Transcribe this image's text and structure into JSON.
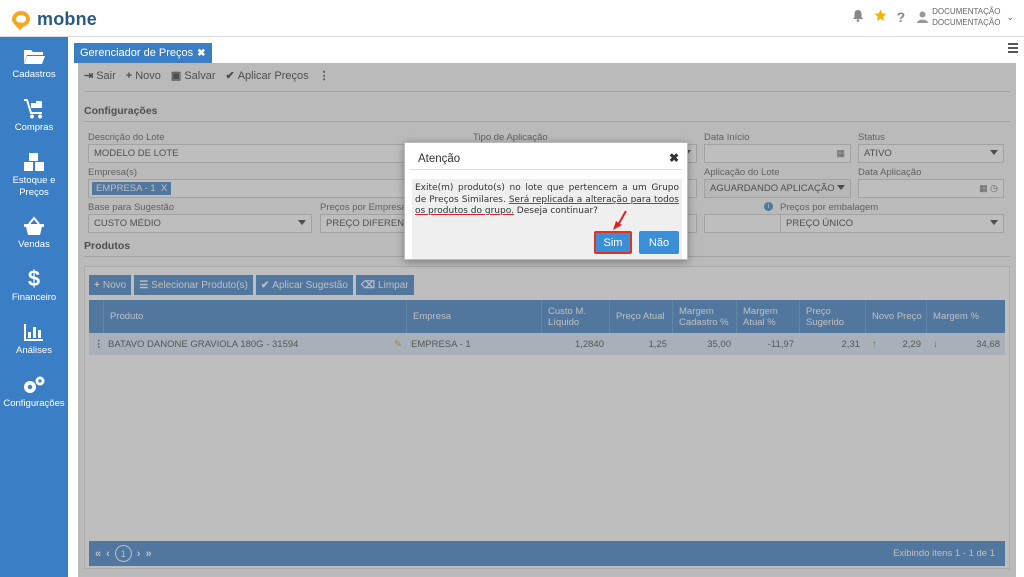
{
  "app": {
    "name": "mobne"
  },
  "header": {
    "user_line1": "DOCUMENTAÇÃO",
    "user_line2": "DOCUMENTAÇÃO"
  },
  "sidebar": {
    "items": [
      {
        "label": "Cadastros",
        "icon": "folder-icon"
      },
      {
        "label": "Compras",
        "icon": "cart-icon"
      },
      {
        "label": "Estoque e Preços",
        "icon": "boxes-icon"
      },
      {
        "label": "Vendas",
        "icon": "basket-icon"
      },
      {
        "label": "Financeiro",
        "icon": "dollar-icon"
      },
      {
        "label": "Análises",
        "icon": "bar-chart-icon"
      },
      {
        "label": "Configurações",
        "icon": "gears-icon"
      }
    ]
  },
  "tab": {
    "label": "Gerenciador de Preços"
  },
  "toolbar": {
    "exit": "Sair",
    "new": "Novo",
    "save": "Salvar",
    "apply": "Aplicar Preços"
  },
  "config": {
    "title": "Configurações",
    "lot_desc_label": "Descrição do Lote",
    "lot_desc_value": "MODELO DE LOTE",
    "app_type_label": "Tipo de Aplicação",
    "start_date_label": "Data Início",
    "status_label": "Status",
    "status_value": "ATIVO",
    "company_label": "Empresa(s)",
    "company_chip": "EMPRESA - 1",
    "lot_app_label": "Aplicação do Lote",
    "lot_app_value": "AGUARDANDO APLICAÇÃO",
    "app_date_label": "Data Aplicação",
    "base_label": "Base para Sugestão",
    "base_value": "CUSTO MÉDIO",
    "prices_company_label": "Preços por Empresa",
    "prices_company_value": "PREÇO DIFERENCIADO",
    "prices_pack_label": "Preços por embalagem",
    "prices_pack_value": "PREÇO ÚNICO"
  },
  "products": {
    "title": "Produtos",
    "buttons": {
      "new": "Novo",
      "select": "Selecionar Produto(s)",
      "apply_suggestion": "Aplicar Sugestão",
      "clear": "Limpar"
    },
    "columns": [
      "Produto",
      "Empresa",
      "Custo M. Líquido",
      "Preço Atual",
      "Margem Cadastro %",
      "Margem Atual %",
      "Preço Sugerido",
      "Novo Preço",
      "Margem %"
    ],
    "rows": [
      {
        "product": "BATAVO DANONE GRAVIOLA 180G - 31594",
        "company": "EMPRESA - 1",
        "cost": "1,2840",
        "current_price": "1,25",
        "margin_reg": "35,00",
        "margin_cur": "-11,97",
        "suggested": "2,31",
        "new_price": "2,29",
        "margin": "34,68"
      }
    ],
    "page": "1",
    "status": "Exibindo itens 1 - 1 de 1"
  },
  "modal": {
    "title": "Atenção",
    "message_part1": "Exite(m) produto(s) no lote que pertencem a um Grupo de Preços Similares.",
    "message_part2": "Será replicada a alteração para todos os produtos do grupo.",
    "message_part3": "Deseja continuar?",
    "yes": "Sim",
    "no": "Não"
  }
}
